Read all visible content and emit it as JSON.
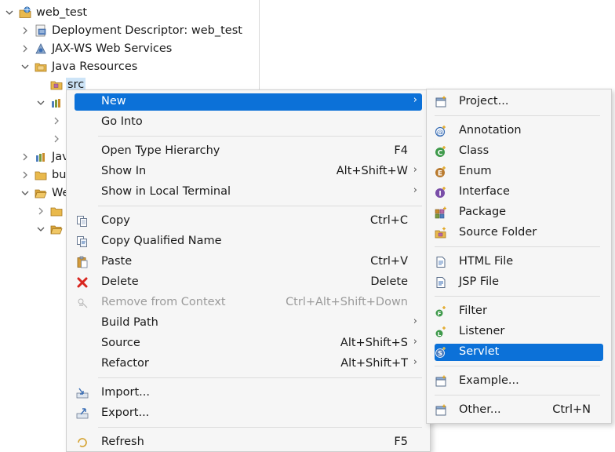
{
  "tree": {
    "project": "web_test",
    "items": [
      {
        "label": "Deployment Descriptor: web_test"
      },
      {
        "label": "JAX-WS Web Services"
      },
      {
        "label": "Java Resources"
      },
      {
        "label": "src"
      },
      {
        "label": ""
      },
      {
        "label": "Jav"
      },
      {
        "label": "bu"
      },
      {
        "label": "We"
      }
    ]
  },
  "context_menu": {
    "items": [
      {
        "label": "New"
      },
      {
        "label": "Go Into"
      },
      {
        "label": "Open Type Hierarchy",
        "shortcut": "F4"
      },
      {
        "label": "Show In",
        "shortcut": "Alt+Shift+W"
      },
      {
        "label": "Show in Local Terminal"
      },
      {
        "label": "Copy",
        "shortcut": "Ctrl+C"
      },
      {
        "label": "Copy Qualified Name"
      },
      {
        "label": "Paste",
        "shortcut": "Ctrl+V"
      },
      {
        "label": "Delete",
        "shortcut": "Delete"
      },
      {
        "label": "Remove from Context",
        "shortcut": "Ctrl+Alt+Shift+Down"
      },
      {
        "label": "Build Path"
      },
      {
        "label": "Source",
        "shortcut": "Alt+Shift+S"
      },
      {
        "label": "Refactor",
        "shortcut": "Alt+Shift+T"
      },
      {
        "label": "Import..."
      },
      {
        "label": "Export..."
      },
      {
        "label": "Refresh",
        "shortcut": "F5"
      }
    ]
  },
  "new_submenu": {
    "items": [
      {
        "label": "Project..."
      },
      {
        "label": "Annotation"
      },
      {
        "label": "Class"
      },
      {
        "label": "Enum"
      },
      {
        "label": "Interface"
      },
      {
        "label": "Package"
      },
      {
        "label": "Source Folder"
      },
      {
        "label": "HTML File"
      },
      {
        "label": "JSP File"
      },
      {
        "label": "Filter"
      },
      {
        "label": "Listener"
      },
      {
        "label": "Servlet"
      },
      {
        "label": "Example..."
      },
      {
        "label": "Other...",
        "shortcut": "Ctrl+N"
      }
    ]
  },
  "colors": {
    "highlight": "#0c71d8",
    "tree_selection": "#cde4f7",
    "menu_background": "#f6f6f6"
  }
}
